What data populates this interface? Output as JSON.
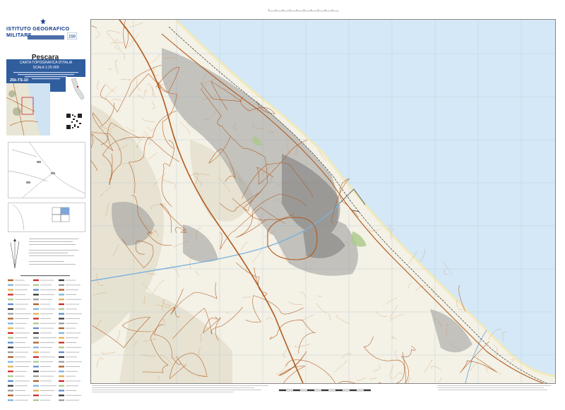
{
  "header": {
    "institute": "ISTITUTO GEOGRAFICO MILITARE",
    "badge": "150"
  },
  "sheet": {
    "title": "Pescara",
    "series_line1": "CARTA TOPOGRAFICA D'ITALIA",
    "series_line2": "SCALA 1:25 000",
    "code": "25k-TS-10"
  },
  "map": {
    "sea_color": "#d4e8f7",
    "land_color": "#f4f1e6",
    "road_color": "#b05a1e",
    "urban_color": "#8a8a8a",
    "frame_color": "#888888"
  }
}
